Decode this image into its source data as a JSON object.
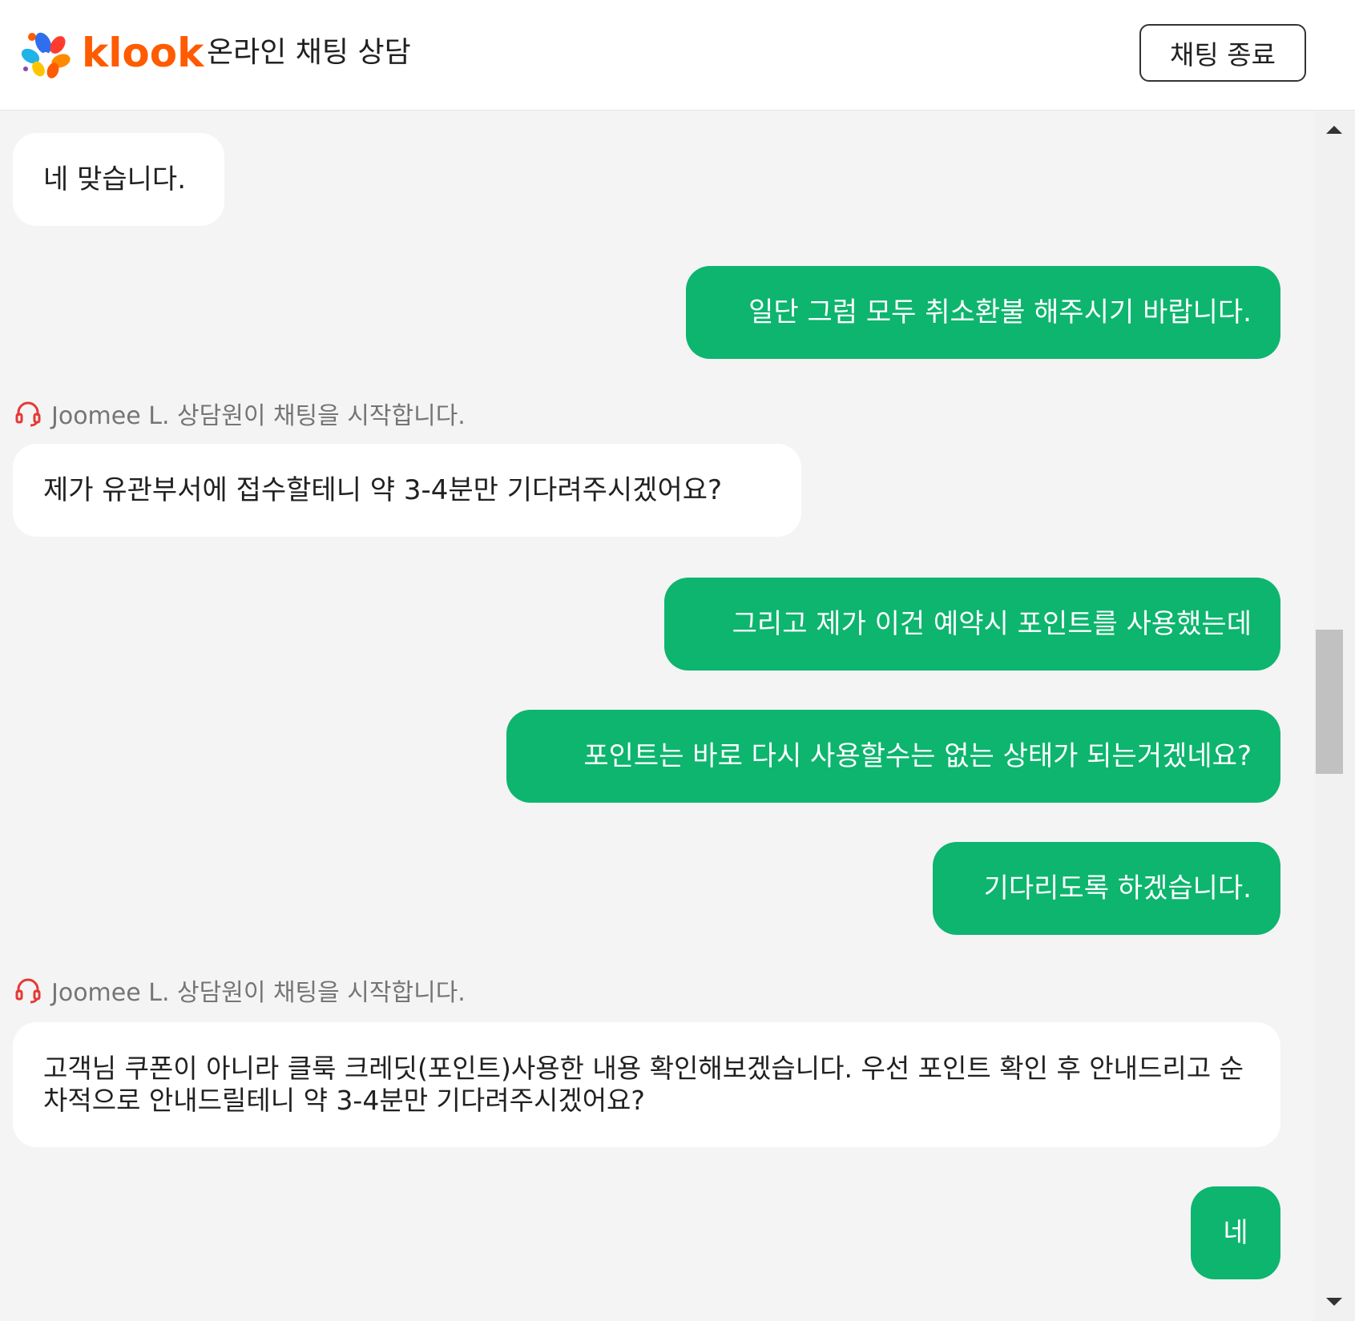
{
  "header": {
    "logo_text": "klook",
    "title": "온라인 채팅 상담",
    "end_chat_label": "채팅 종료"
  },
  "messages": [
    {
      "sender": "agent",
      "text": "네 맞습니다."
    },
    {
      "sender": "user",
      "text": "일단 그럼 모두 취소환불 해주시기 바랍니다."
    },
    {
      "sender": "system",
      "text": "Joomee L. 상담원이 채팅을 시작합니다."
    },
    {
      "sender": "agent",
      "text": "제가 유관부서에 접수할테니 약 3-4분만 기다려주시겠어요?"
    },
    {
      "sender": "user",
      "text": "그리고 제가 이건 예약시 포인트를 사용했는데"
    },
    {
      "sender": "user",
      "text": "포인트는 바로 다시 사용할수는 없는 상태가 되는거겠네요?"
    },
    {
      "sender": "user",
      "text": "기다리도록 하겠습니다."
    },
    {
      "sender": "system",
      "text": "Joomee L. 상담원이 채팅을 시작합니다."
    },
    {
      "sender": "agent",
      "text": "고객님 쿠폰이 아니라 클룩 크레딧(포인트)사용한 내용 확인해보겠습니다. 우선 포인트 확인 후 안내드리고 순차적으로 안내드릴테니 약 3-4분만 기다려주시겠어요?"
    },
    {
      "sender": "user",
      "text": "네"
    }
  ],
  "colors": {
    "brand_orange": "#ff5b00",
    "user_bubble": "#0db56e",
    "agent_bubble": "#ffffff",
    "background": "#f4f4f4",
    "system_text": "#757575",
    "headset_icon": "#e53935"
  },
  "icons": {
    "logo": "klook-logo-icon",
    "system": "headset-icon",
    "scroll_up": "arrow-up-icon",
    "scroll_down": "arrow-down-icon"
  }
}
